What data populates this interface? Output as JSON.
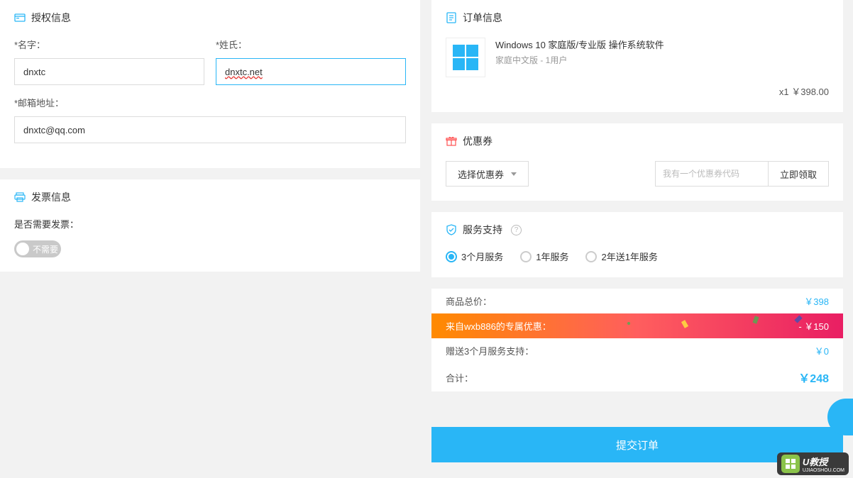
{
  "auth": {
    "title": "授权信息",
    "first_name_label": "*名字：",
    "first_name_value": "dnxtc",
    "last_name_label": "*姓氏：",
    "last_name_value": "dnxtc.net",
    "email_label": "*邮箱地址：",
    "email_value": "dnxtc@qq.com"
  },
  "invoice": {
    "title": "发票信息",
    "question": "是否需要发票：",
    "toggle_label": "不需要"
  },
  "order": {
    "title": "订单信息",
    "product_name": "Windows 10 家庭版/专业版 操作系统软件",
    "product_desc": "家庭中文版 - 1用户",
    "qty_price": "x1 ￥398.00"
  },
  "coupon": {
    "title": "优惠券",
    "dropdown_label": "选择优惠券",
    "code_placeholder": "我有一个优惠券代码",
    "redeem_label": "立即领取"
  },
  "service": {
    "title": "服务支持",
    "options": [
      "3个月服务",
      "1年服务",
      "2年送1年服务"
    ]
  },
  "summary": {
    "rows": [
      {
        "label": "商品总价：",
        "value": "￥398"
      },
      {
        "label": "来自wxb886的专属优惠：",
        "value": "- ￥150"
      },
      {
        "label": "赠送3个月服务支持：",
        "value": "￥0"
      },
      {
        "label": "合计：",
        "value": "￥248"
      }
    ]
  },
  "submit_label": "提交订单",
  "watermark": {
    "brand": "U教授",
    "url": "UJIAOSHOU.COM"
  }
}
